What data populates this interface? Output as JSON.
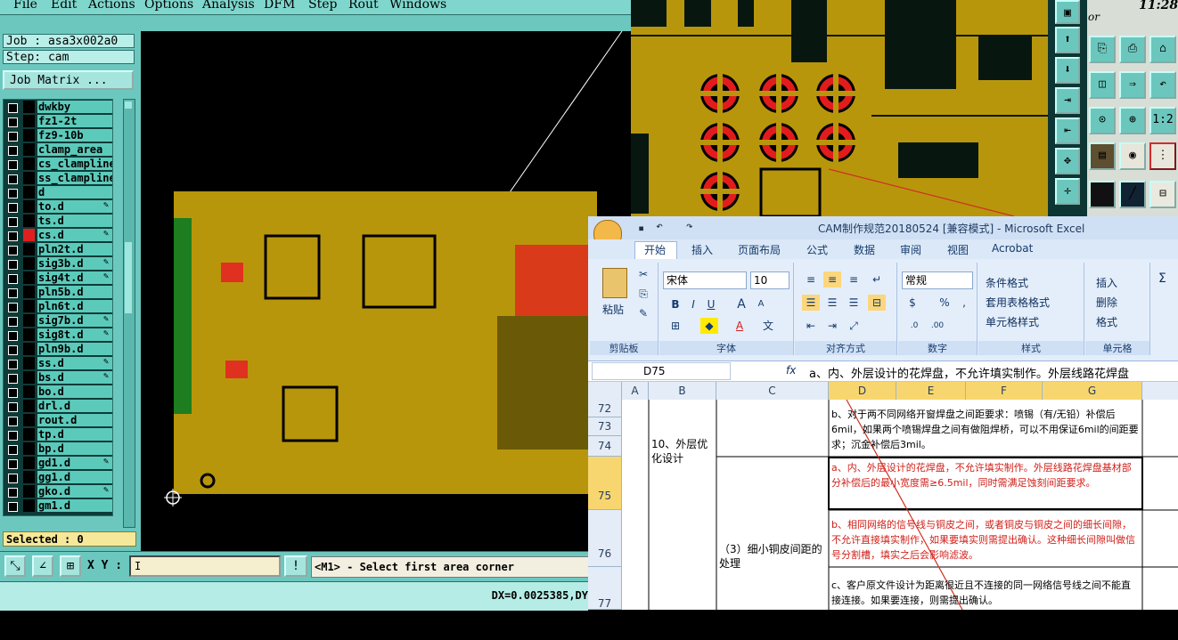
{
  "menubar": {
    "items": [
      "File",
      "Edit",
      "Actions",
      "Options",
      "Analysis",
      "DFM",
      "Step",
      "Rout",
      "Windows"
    ]
  },
  "clock": {
    "time": "11:28",
    "label": "or"
  },
  "left": {
    "job": "Job : asa3x002a0",
    "step": "Step: cam",
    "job_matrix": "Job Matrix ...",
    "layers": [
      {
        "name": "dwkby",
        "color": "#000000",
        "editable": false
      },
      {
        "name": "fz1-2t",
        "color": "#000000",
        "editable": false
      },
      {
        "name": "fz9-10b",
        "color": "#000000",
        "editable": false
      },
      {
        "name": "clamp_area",
        "color": "#000000",
        "editable": false
      },
      {
        "name": "cs_clampline",
        "color": "#000000",
        "editable": false
      },
      {
        "name": "ss_clampline",
        "color": "#000000",
        "editable": false
      },
      {
        "name": "d",
        "color": "#000000",
        "editable": false
      },
      {
        "name": "to.d",
        "color": "#000000",
        "editable": true
      },
      {
        "name": "ts.d",
        "color": "#000000",
        "editable": false
      },
      {
        "name": "cs.d",
        "color": "#e02020",
        "editable": true
      },
      {
        "name": "pln2t.d",
        "color": "#000000",
        "editable": false
      },
      {
        "name": "sig3b.d",
        "color": "#000000",
        "editable": true
      },
      {
        "name": "sig4t.d",
        "color": "#000000",
        "editable": true
      },
      {
        "name": "pln5b.d",
        "color": "#000000",
        "editable": false
      },
      {
        "name": "pln6t.d",
        "color": "#000000",
        "editable": false
      },
      {
        "name": "sig7b.d",
        "color": "#000000",
        "editable": true
      },
      {
        "name": "sig8t.d",
        "color": "#000000",
        "editable": true
      },
      {
        "name": "pln9b.d",
        "color": "#000000",
        "editable": false
      },
      {
        "name": "ss.d",
        "color": "#000000",
        "editable": true
      },
      {
        "name": "bs.d",
        "color": "#000000",
        "editable": true
      },
      {
        "name": "bo.d",
        "color": "#000000",
        "editable": false
      },
      {
        "name": "drl.d",
        "color": "#000000",
        "editable": false
      },
      {
        "name": "rout.d",
        "color": "#000000",
        "editable": false
      },
      {
        "name": "tp.d",
        "color": "#000000",
        "editable": false
      },
      {
        "name": "bp.d",
        "color": "#000000",
        "editable": false
      },
      {
        "name": "gd1.d",
        "color": "#000000",
        "editable": true
      },
      {
        "name": "gg1.d",
        "color": "#000000",
        "editable": false
      },
      {
        "name": "gko.d",
        "color": "#000000",
        "editable": true
      },
      {
        "name": "gm1.d",
        "color": "#000000",
        "editable": false
      }
    ],
    "selected": "Selected : 0"
  },
  "bottom": {
    "xy_label": "X Y :",
    "xy_value": "I",
    "alert_icon": "!",
    "prompt": "<M1> - Select first area corner",
    "dx": "DX=0.0025385,DY"
  },
  "right_tools": {
    "labels": [
      "1:2"
    ]
  },
  "excel": {
    "title": "CAM制作规范20180524  [兼容模式] - Microsoft Excel",
    "tabs": [
      "开始",
      "插入",
      "页面布局",
      "公式",
      "数据",
      "审阅",
      "视图",
      "Acrobat"
    ],
    "ribbon": {
      "clipboard": {
        "paste": "粘贴",
        "label": "剪贴板"
      },
      "font": {
        "name": "宋体",
        "size": "10",
        "bold": "B",
        "italic": "I",
        "underline": "U",
        "grow": "A",
        "shrink": "A",
        "color_a": "A",
        "wen": "文",
        "label": "字体"
      },
      "align": {
        "label": "对齐方式"
      },
      "number": {
        "format": "常规",
        "pct": "%",
        "comma": ",",
        "label": "数字"
      },
      "styles": {
        "cond": "条件格式",
        "table": "套用表格格式",
        "cell": "单元格样式",
        "label": "样式"
      },
      "cells": {
        "insert": "插入",
        "delete": "删除",
        "format": "格式",
        "label": "单元格"
      },
      "edit": {
        "sigma": "Σ"
      }
    },
    "namebox": "D75",
    "fx": "fx",
    "formula": "a、内、外层设计的花焊盘，不允许填实制作。外层线路花焊盘",
    "columns": [
      "A",
      "B",
      "C",
      "D",
      "E",
      "F",
      "G"
    ],
    "rows": {
      "r72": "72",
      "r73": "73",
      "r74": "74",
      "r75": "75",
      "r76": "76",
      "r77": "77"
    },
    "cells": {
      "b_section": "10、外层优化设计",
      "c_section": "（3）细小铜皮间距的处理",
      "d72": "b、对于两不同网络开窗焊盘之间距要求：喷锡（有/无铅）补偿后6mil，如果两个喷锡焊盘之间有做阻焊桥，可以不用保证6mil的间距要求；沉金补偿后3mil。",
      "d75": "a、内、外层设计的花焊盘，不允许填实制作。外层线路花焊盘基材部分补偿后的最小宽度需≥6.5mil，同时需满足蚀刻间距要求。",
      "d76": "b、相同网络的信号线与铜皮之间，或者铜皮与铜皮之间的细长间隙，不允许直接填实制作，如果要填实则需提出确认。这种细长间隙叫做信号分割槽，填实之后会影响滤波。",
      "d77": "c、客户原文件设计为距离很近且不连接的同一网络信号线之间不能直接连接。如果要连接，则需提出确认。"
    }
  }
}
